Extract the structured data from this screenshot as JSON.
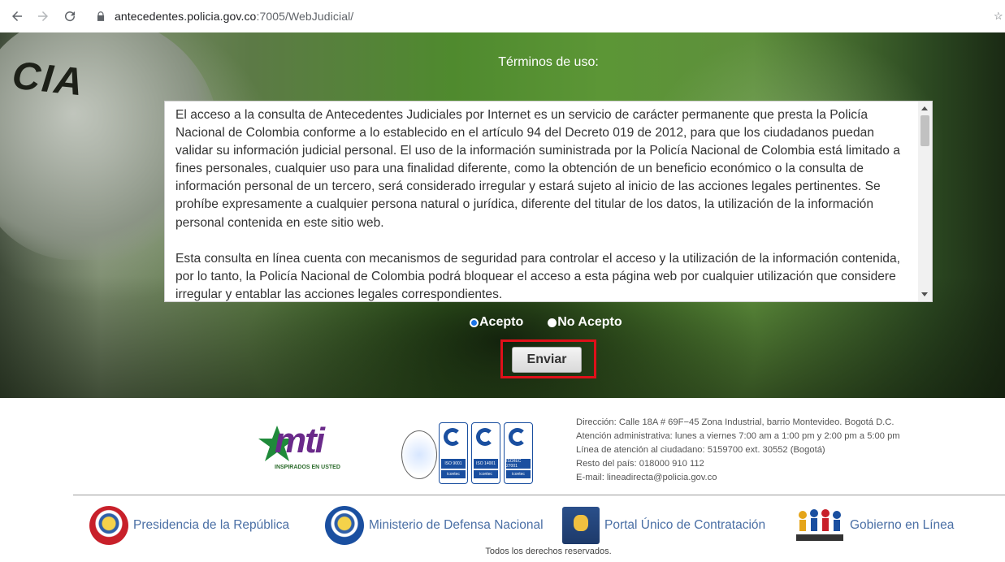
{
  "browser": {
    "url_host": "antecedentes.policia.gov.co",
    "url_path": ":7005/WebJudicial/"
  },
  "hero": {
    "shirt_text": "CIA"
  },
  "terms": {
    "title": "Términos de uso:",
    "paragraphs": [
      "El acceso a la consulta de Antecedentes Judiciales por Internet es un servicio de carácter permanente que presta la Policía Nacional de Colombia conforme a lo establecido en el artículo 94 del Decreto 019 de 2012, para que los ciudadanos puedan validar su información judicial personal. El uso de la información suministrada por la Policía Nacional de Colombia está limitado a fines personales, cualquier uso para una finalidad diferente, como la obtención de un beneficio económico o la consulta de información personal de un tercero, será considerado irregular y estará sujeto al inicio de las acciones legales pertinentes. Se prohíbe expresamente a cualquier persona natural o jurídica, diferente del titular de los datos, la utilización de la información personal contenida en este sitio web.",
      "Esta consulta en línea cuenta con mecanismos de seguridad para controlar el acceso y la utilización de la información contenida, por lo tanto, la Policía Nacional de Colombia podrá bloquear el acceso a esta página web por cualquier utilización que considere irregular y entablar las acciones legales correspondientes."
    ]
  },
  "form": {
    "accept_label": "Acepto",
    "reject_label": "No Acepto",
    "selected": "Acepto",
    "submit_label": "Enviar"
  },
  "footer": {
    "mti_text": "mti",
    "mti_tagline": "INSPIRADOS EN USTED",
    "contact": [
      "Dirección: Calle 18A # 69F−45 Zona Industrial, barrio Montevideo. Bogotá D.C.",
      "Atención administrativa: lunes a viernes 7:00 am a 1:00 pm y 2:00 pm a 5:00 pm",
      "Línea de atención al ciudadano: 5159700 ext. 30552 (Bogotá)",
      "Resto del país: 018000 910 112",
      "E-mail: lineadirecta@policia.gov.co"
    ],
    "certs": [
      "ISO 9001",
      "ISO 14001",
      "ISO/IEC 27001"
    ],
    "links": [
      {
        "label": "Presidencia de la República"
      },
      {
        "label": "Ministerio de Defensa Nacional"
      },
      {
        "label": "Portal Único de Contratación"
      },
      {
        "label": "Gobierno en Línea"
      }
    ],
    "copyright": "Todos los derechos reservados."
  },
  "colors": {
    "highlight": "#e0101a",
    "link": "#4a6fa5",
    "radio_checked": "#1a73e8"
  }
}
